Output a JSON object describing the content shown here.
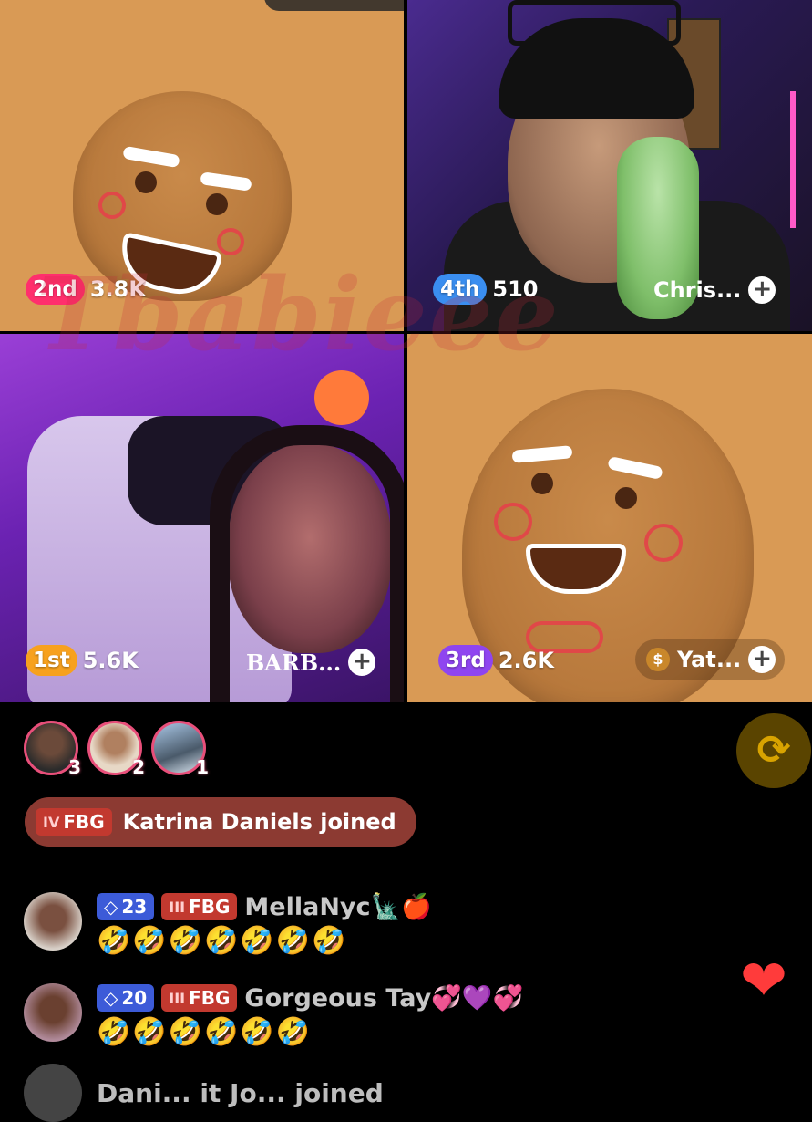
{
  "grid": {
    "tiles": [
      {
        "rank": "2nd",
        "score": "3.8K"
      },
      {
        "rank": "4th",
        "score": "510",
        "name": "Chris..."
      },
      {
        "rank": "1st",
        "score": "5.6K",
        "name": "BARB..."
      },
      {
        "rank": "3rd",
        "score": "2.6K",
        "name": "Yat...",
        "name_icon": "money-bag-icon"
      }
    ],
    "add_label": "+",
    "watermark": "Tbabieee"
  },
  "viewers": [
    {
      "num": "3"
    },
    {
      "num": "2"
    },
    {
      "num": "1"
    }
  ],
  "share_icon": "repost-icon",
  "joined": {
    "badge": "FBG",
    "badge_level": "IV",
    "text": "Katrina Daniels joined"
  },
  "messages": [
    {
      "level": "23",
      "badge": "FBG",
      "badge_level": "III",
      "user": "MellaNyc🗽🍎",
      "text": "🤣🤣🤣🤣🤣🤣🤣"
    },
    {
      "level": "20",
      "badge": "FBG",
      "badge_level": "III",
      "user": "Gorgeous Tay💞💜💞",
      "text": "🤣🤣🤣🤣🤣🤣"
    }
  ],
  "like_icon": "heart-icon",
  "partial_text": "Dani... it Jo... joined"
}
